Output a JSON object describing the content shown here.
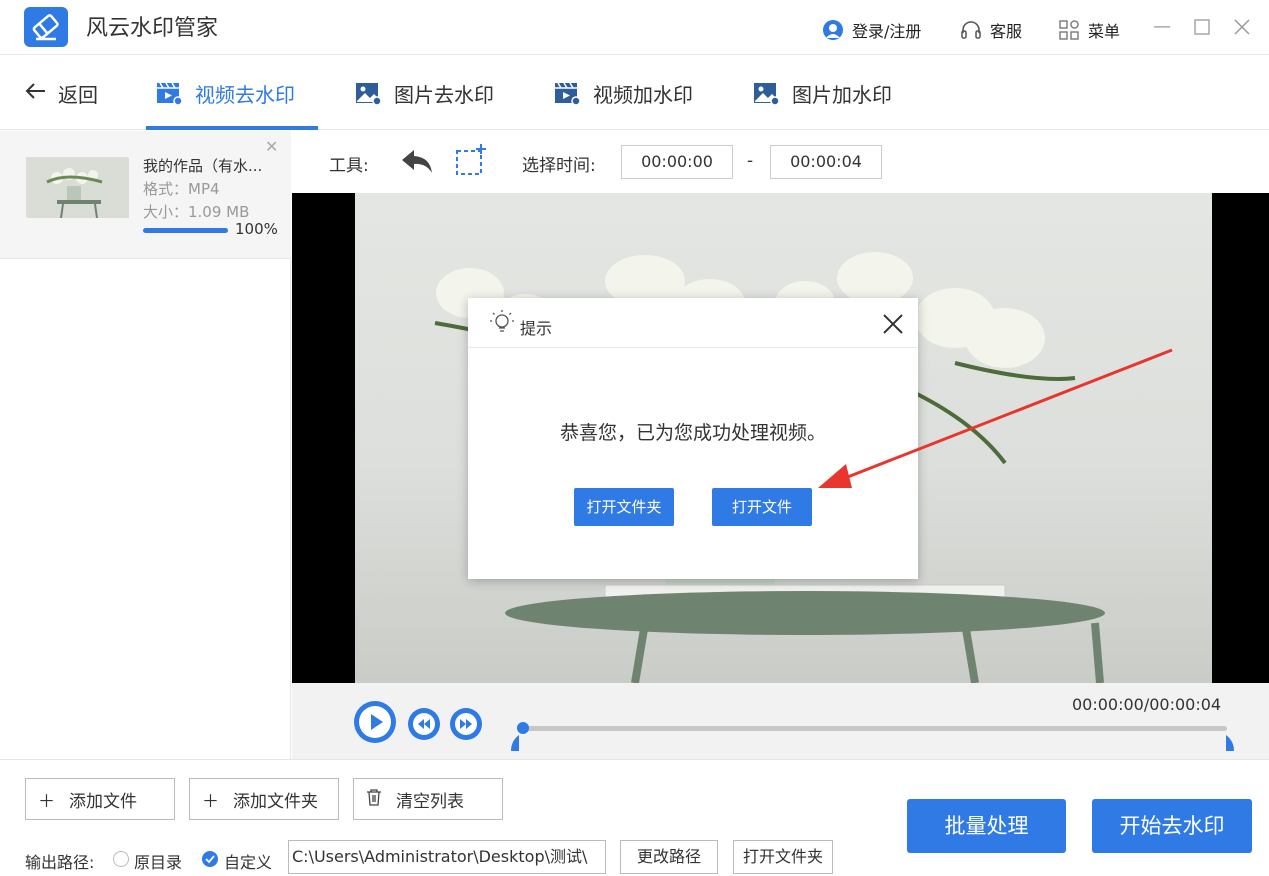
{
  "app": {
    "title": "风云水印管家"
  },
  "titlebar": {
    "login": "登录/注册",
    "service": "客服",
    "menu": "菜单"
  },
  "nav": {
    "back": "返回",
    "tabs": [
      {
        "label": "视频去水印",
        "active": true
      },
      {
        "label": "图片去水印",
        "active": false
      },
      {
        "label": "视频加水印",
        "active": false
      },
      {
        "label": "图片加水印",
        "active": false
      }
    ]
  },
  "file": {
    "name": "我的作品（有水...",
    "format": "格式：MP4",
    "size": "大小：1.09 MB",
    "progress_pct": 100,
    "progress_label": "100%"
  },
  "toolbar": {
    "tools_label": "工具:",
    "time_label": "选择时间:",
    "start_time": "00:00:00",
    "dash": "-",
    "end_time": "00:00:04"
  },
  "player": {
    "time": "00:00:00/00:00:04"
  },
  "bottom": {
    "add_file": "添加文件",
    "add_folder": "添加文件夹",
    "clear_list": "清空列表",
    "output_label": "输出路径:",
    "opt_original": "原目录",
    "opt_custom": "自定义",
    "path_value": "C:\\Users\\Administrator\\Desktop\\测试\\",
    "change_path": "更改路径",
    "open_folder": "打开文件夹",
    "batch": "批量处理",
    "start": "开始去水印"
  },
  "dialog": {
    "title": "提示",
    "message": "恭喜您，已为您成功处理视频。",
    "open_folder": "打开文件夹",
    "open_file": "打开文件"
  },
  "colors": {
    "accent": "#2f7ae5",
    "arrow": "#e8352e"
  }
}
